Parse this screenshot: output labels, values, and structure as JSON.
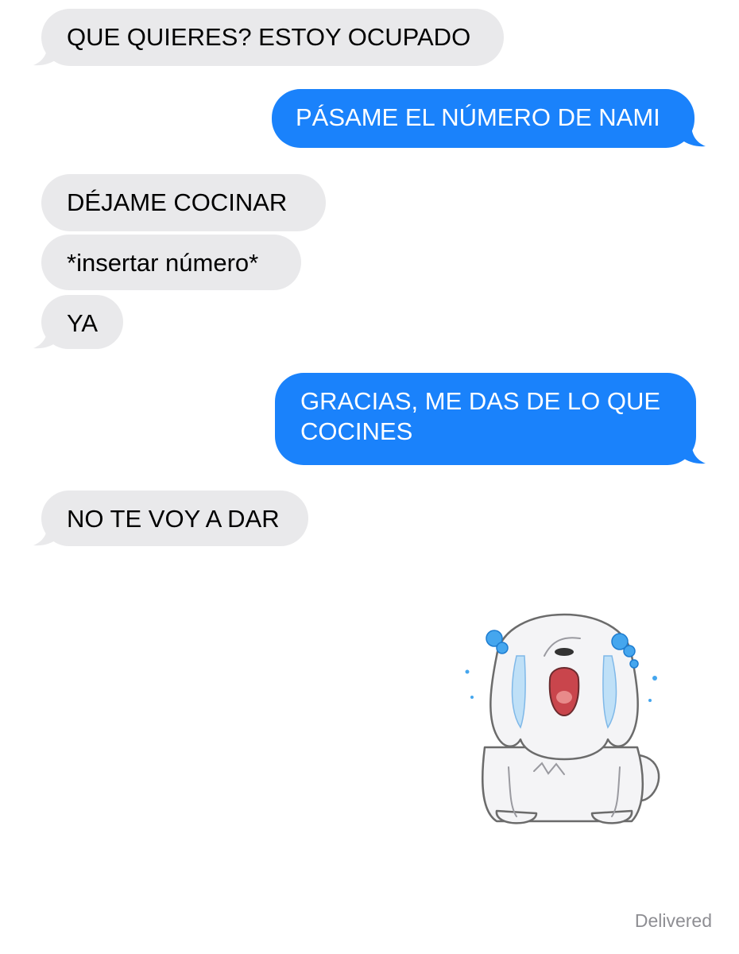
{
  "messages": [
    {
      "direction": "incoming",
      "text": "QUE QUIERES? ESTOY OCUPADO"
    },
    {
      "direction": "outgoing",
      "text": "PÁSAME EL NÚMERO DE NAMI"
    },
    {
      "direction": "incoming",
      "text": "DÉJAME COCINAR"
    },
    {
      "direction": "incoming",
      "text": "*insertar número*"
    },
    {
      "direction": "incoming",
      "text": "YA"
    },
    {
      "direction": "outgoing",
      "text": "GRACIAS, ME DAS DE LO QUE COCINES"
    },
    {
      "direction": "incoming",
      "text": "NO TE VOY A DAR"
    }
  ],
  "sticker": {
    "icon": "crying-white-dog-sticker"
  },
  "status": {
    "delivered_label": "Delivered"
  },
  "colors": {
    "incoming_bubble": "#e9e9eb",
    "outgoing_bubble": "#1a82fb",
    "status_text": "#8e8e93"
  }
}
